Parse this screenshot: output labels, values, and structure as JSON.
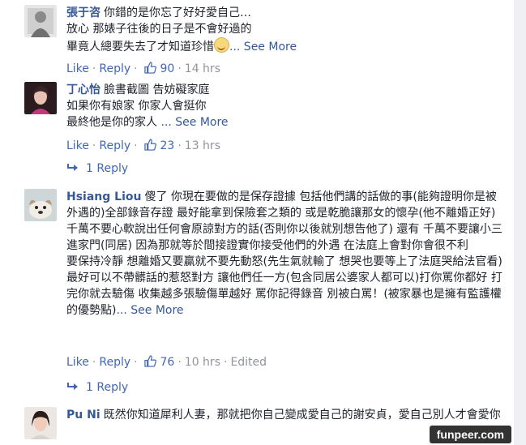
{
  "comments": [
    {
      "name": "張于咨",
      "text_lines": [
        "你錯的是你忘了好好愛自己…",
        "放心 那婊子往後的日子是不會好過的",
        "畢竟人總要失去了才知道珍惜"
      ],
      "see_more": "... See More",
      "like": "Like",
      "reply": "Reply",
      "likes": "90",
      "time": "14 hrs"
    },
    {
      "name": "丁心怡",
      "text_lines": [
        "臉書截圖 告妨礙家庭",
        "如果你有娘家 你家人會挺你",
        "最終他是你的家人"
      ],
      "see_more": " ... See More",
      "like": "Like",
      "reply": "Reply",
      "likes": "23",
      "time": "13 hrs",
      "replies_label": "1 Reply"
    },
    {
      "name": "Hsiang Liou",
      "text_lines": [
        "傻了 你現在要做的是保存證據 包括他們講的話做的事(能夠證明你是被外遇的)全部錄音存證 最好能拿到保險套之類的 或是乾脆讓那女的懷孕(他不離婚正好)",
        "千萬不要心軟說出任何會原諒對方的話(否則你以後就別想告他了) 還有 千萬不要讓小三進家門(同居) 因為那就等於間接證實你接受他們的外遇 在法庭上會對你會很不利",
        "要保持冷靜 想離婚又要贏就不要先動怒(先生氣就輸了 想哭也要等上了法庭哭給法官看) 最好可以不帶髒話的惹怒對方 讓他們任一方(包含同居公婆家人都可以)打你罵你都好 打完你就去驗傷 收集越多張驗傷單越好 罵你記得錄音 別被白罵！(被家暴也是擁有監護權的優勢點)"
      ],
      "see_more": "... See More",
      "like": "Like",
      "reply": "Reply",
      "likes": "76",
      "time": "10 hrs",
      "edited": "Edited",
      "replies_label": "1 Reply"
    },
    {
      "name": "Pu Ni",
      "text_lines": [
        "既然你知道犀利人妻，那就把你自己變成愛自己的謝安貞，愛自己別人才會愛你"
      ]
    }
  ],
  "watermark": "funpeer.com",
  "colors": {
    "link": "#365899",
    "action": "#4267b2",
    "meta": "#90949c",
    "text": "#1d2129"
  }
}
